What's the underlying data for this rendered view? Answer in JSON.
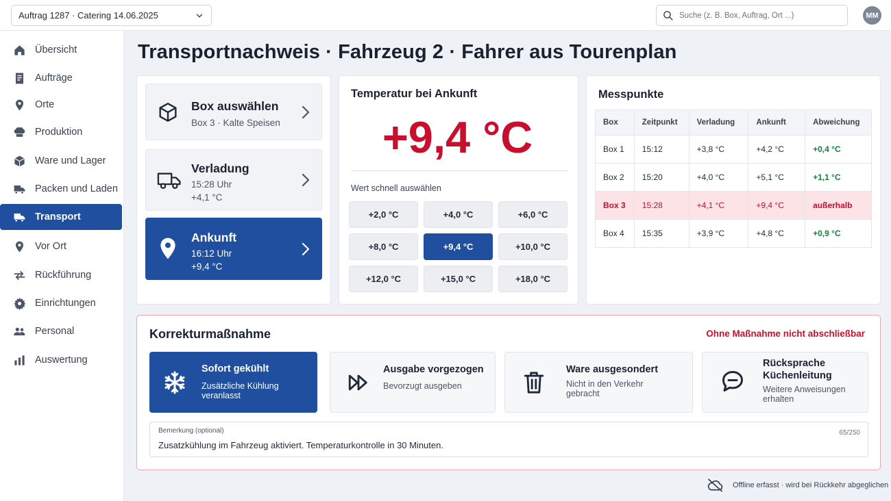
{
  "topbar": {
    "order_select": "Auftrag 1287 · Catering 14.06.2025",
    "search_placeholder": "Suche (z. B. Box, Auftrag, Ort ...)",
    "avatar": "MM"
  },
  "sidebar": {
    "items": [
      {
        "label": "Übersicht",
        "icon": "home-icon"
      },
      {
        "label": "Aufträge",
        "icon": "document-icon"
      },
      {
        "label": "Orte",
        "icon": "location-pin-icon"
      },
      {
        "label": "Produktion",
        "icon": "chef-hat-icon"
      },
      {
        "label": "Ware und Lager",
        "icon": "package-icon"
      },
      {
        "label": "Packen und Laden",
        "icon": "truck-icon"
      },
      {
        "label": "Transport",
        "icon": "truck-icon",
        "active": true
      },
      {
        "label": "Vor Ort",
        "icon": "location-pin-icon"
      },
      {
        "label": "Rückführung",
        "icon": "swap-arrows-icon"
      },
      {
        "label": "Einrichtungen",
        "icon": "gear-icon"
      },
      {
        "label": "Personal",
        "icon": "people-icon"
      },
      {
        "label": "Auswertung",
        "icon": "bar-chart-icon"
      }
    ]
  },
  "page": {
    "title": "Transportnachweis · Fahrzeug 2 · Fahrer aus Tourenplan"
  },
  "steps": {
    "box": {
      "title": "Box auswählen",
      "sub": "Box 3 · Kalte Speisen"
    },
    "verladung": {
      "title": "Verladung",
      "time": "15:28 Uhr",
      "temp": "+4,1 °C"
    },
    "ankunft": {
      "title": "Ankunft",
      "time": "16:12 Uhr",
      "temp": "+9,4 °C"
    }
  },
  "temperature": {
    "title": "Temperatur bei Ankunft",
    "value": "+9,4 °C",
    "quick_label": "Wert schnell auswählen",
    "quick_values": [
      "+2,0 °C",
      "+4,0 °C",
      "+6,0 °C",
      "+8,0 °C",
      "+9,4 °C",
      "+10,0 °C",
      "+12,0 °C",
      "+15,0 °C",
      "+18,0 °C"
    ],
    "selected": "+9,4 °C"
  },
  "messpunkte": {
    "title": "Messpunkte",
    "headers": [
      "Box",
      "Zeitpunkt",
      "Verladung",
      "Ankunft",
      "Abweichung"
    ],
    "rows": [
      [
        "Box 1",
        "15:12",
        "+3,8 °C",
        "+4,2 °C",
        "+0,4 °C"
      ],
      [
        "Box 2",
        "15:20",
        "+4,0 °C",
        "+5,1 °C",
        "+1,1 °C"
      ],
      [
        "Box 3",
        "15:28",
        "+4,1 °C",
        "+9,4 °C",
        "außerhalb"
      ],
      [
        "Box 4",
        "15:35",
        "+3,9 °C",
        "+4,8 °C",
        "+0,9 °C"
      ]
    ]
  },
  "correction": {
    "title": "Korrekturmaßnahme",
    "warning": "Ohne Maßnahme nicht abschließbar",
    "options": [
      {
        "title": "Sofort gekühlt",
        "sub1": "Zusätzliche Kühlung",
        "sub2": "veranlasst",
        "icon": "snowflake-icon"
      },
      {
        "title": "Ausgabe vorgezogen",
        "sub1": "Bevorzugt ausgeben",
        "icon": "fast-forward-icon"
      },
      {
        "title": "Ware ausgesondert",
        "sub1": "Nicht in den Verkehr",
        "sub2": "gebracht",
        "icon": "trash-icon"
      },
      {
        "title1": "Rücksprache",
        "title2": "Küchenleitung",
        "sub1": "Weitere Anweisungen",
        "sub2": "erhalten",
        "icon": "chat-bubble-icon"
      }
    ],
    "remark": {
      "label": "Bemerkung (optional)",
      "count": "65/250",
      "text": "Zusatzkühlung im Fahrzeug aktiviert. Temperaturkontrolle in 30 Minuten."
    }
  },
  "footer": {
    "offline": "Offline erfasst · wird bei Rückkehr abgeglichen"
  },
  "colors": {
    "primary": "#1f4f9e",
    "alert": "#c8102e",
    "ok": "#15803d"
  }
}
